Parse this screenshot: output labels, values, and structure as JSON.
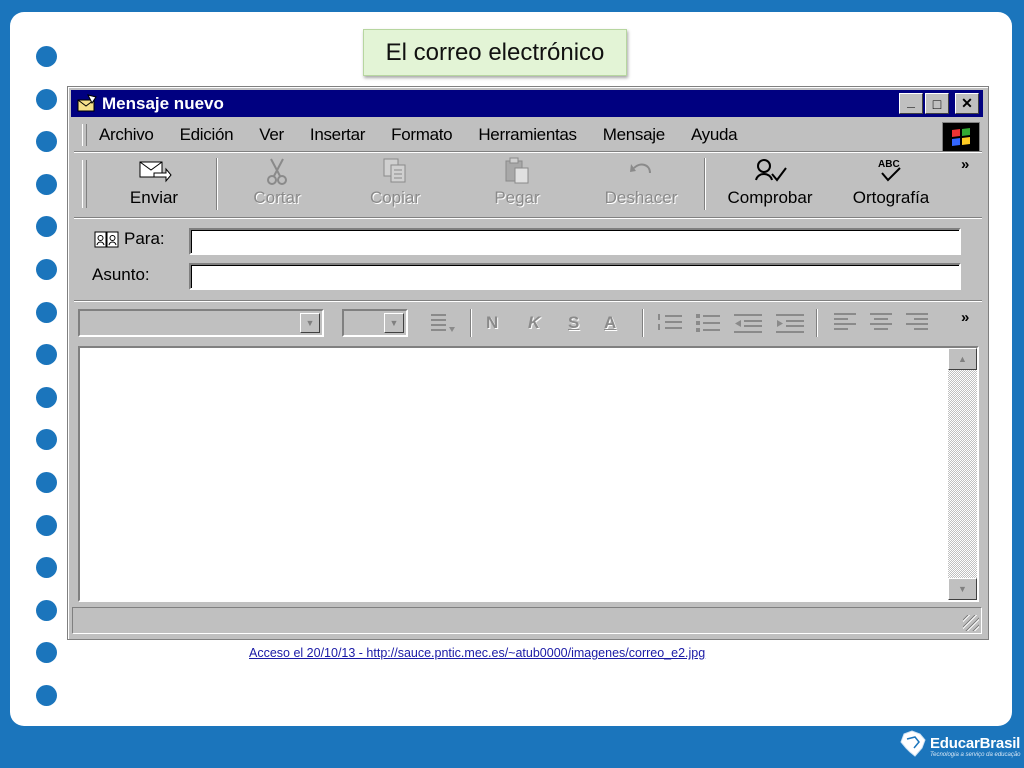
{
  "slide": {
    "title": "El correo electrónico",
    "caption": "Acceso el 20/10/13 - http://sauce.pntic.mec.es/~atub0000/imagenes/correo_e2.jpg",
    "brand": "EducarBrasil",
    "brand_tagline": "Tecnologia a serviço da educação"
  },
  "window": {
    "title": "Mensaje nuevo",
    "buttons": {
      "minimize": "_",
      "maximize": "□",
      "close": "✕"
    }
  },
  "menu": [
    "Archivo",
    "Edición",
    "Ver",
    "Insertar",
    "Formato",
    "Herramientas",
    "Mensaje",
    "Ayuda"
  ],
  "toolbar": [
    {
      "label": "Enviar",
      "icon": "send-icon",
      "enabled": true
    },
    {
      "label": "Cortar",
      "icon": "scissors-icon",
      "enabled": false
    },
    {
      "label": "Copiar",
      "icon": "copy-icon",
      "enabled": false
    },
    {
      "label": "Pegar",
      "icon": "paste-icon",
      "enabled": false
    },
    {
      "label": "Deshacer",
      "icon": "undo-icon",
      "enabled": false
    },
    {
      "label": "Comprobar",
      "icon": "check-names-icon",
      "enabled": true
    },
    {
      "label": "Ortografía",
      "icon": "spelling-icon",
      "enabled": true
    }
  ],
  "overflow": "»",
  "fields": {
    "to_label": "Para:",
    "to_value": "",
    "subject_label": "Asunto:",
    "subject_value": ""
  },
  "format": {
    "font_value": "",
    "size_value": "",
    "bold": "N",
    "italic": "K",
    "underline": "S",
    "color": "A"
  },
  "message_body": "",
  "colors": {
    "titlebar": "#000080",
    "chrome": "#c0c0c0",
    "slide_frame": "#1b75bc",
    "title_box": "#e3f4d6"
  }
}
